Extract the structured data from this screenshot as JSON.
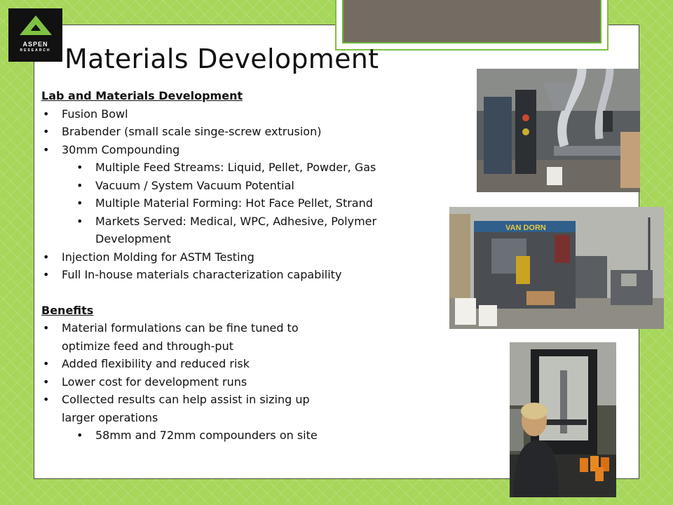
{
  "logo": {
    "word1": "ASPEN",
    "word2": "RESEARCH"
  },
  "title": "Materials Development",
  "lab_section": {
    "heading": "Lab and Materials Development",
    "items": [
      "Fusion Bowl",
      "Brabender (small scale singe-screw extrusion)",
      "30mm Compounding"
    ],
    "sub_items": [
      "Multiple Feed Streams: Liquid, Pellet, Powder, Gas",
      "Vacuum / System Vacuum Potential",
      "Multiple Material Forming: Hot Face Pellet, Strand",
      "Markets Served: Medical, WPC, Adhesive, Polymer"
    ],
    "sub_item_continuation": "Development",
    "items_after": [
      "Injection Molding for ASTM Testing",
      "Full In-house materials characterization capability"
    ]
  },
  "benefits": {
    "heading": "Benefits",
    "item1": "Material formulations can be fine tuned to",
    "item1_cont": "optimize feed and through-put",
    "item2": "Added flexibility and reduced risk",
    "item3": "Lower cost for development runs",
    "item4": "Collected results can help assist in sizing up",
    "item4_cont": "larger  operations",
    "sub_item": "58mm and 72mm compounders on site"
  },
  "photos": {
    "p2_machine_label": "VAN DORN"
  },
  "colors": {
    "background": "#a6d65a",
    "accent_green": "#6bb538",
    "frame_fill": "#746c62"
  }
}
